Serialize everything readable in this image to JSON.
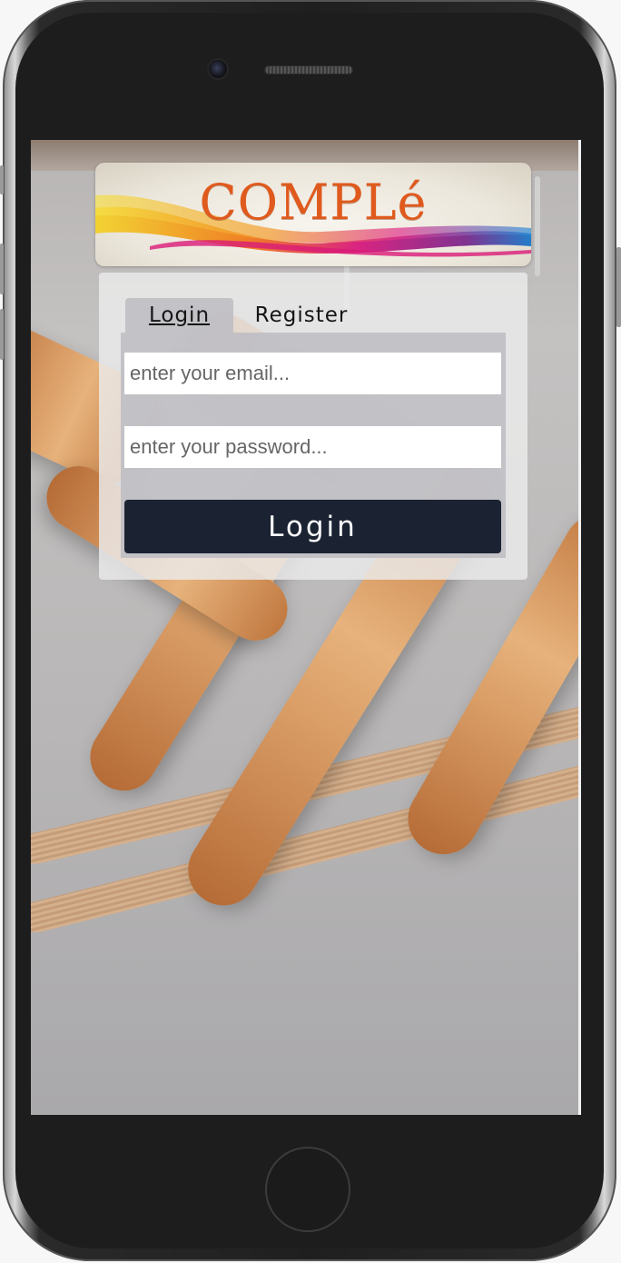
{
  "app": {
    "logo_text": "COMPLé"
  },
  "tabs": [
    {
      "label": "Login",
      "active": true
    },
    {
      "label": "Register",
      "active": false
    }
  ],
  "form": {
    "email_placeholder": "enter your email...",
    "email_value": "",
    "password_placeholder": "enter your password...",
    "password_value": "",
    "submit_label": "Login"
  },
  "colors": {
    "submit_bg": "#1b2333",
    "logo_text": "#e05a1d"
  }
}
